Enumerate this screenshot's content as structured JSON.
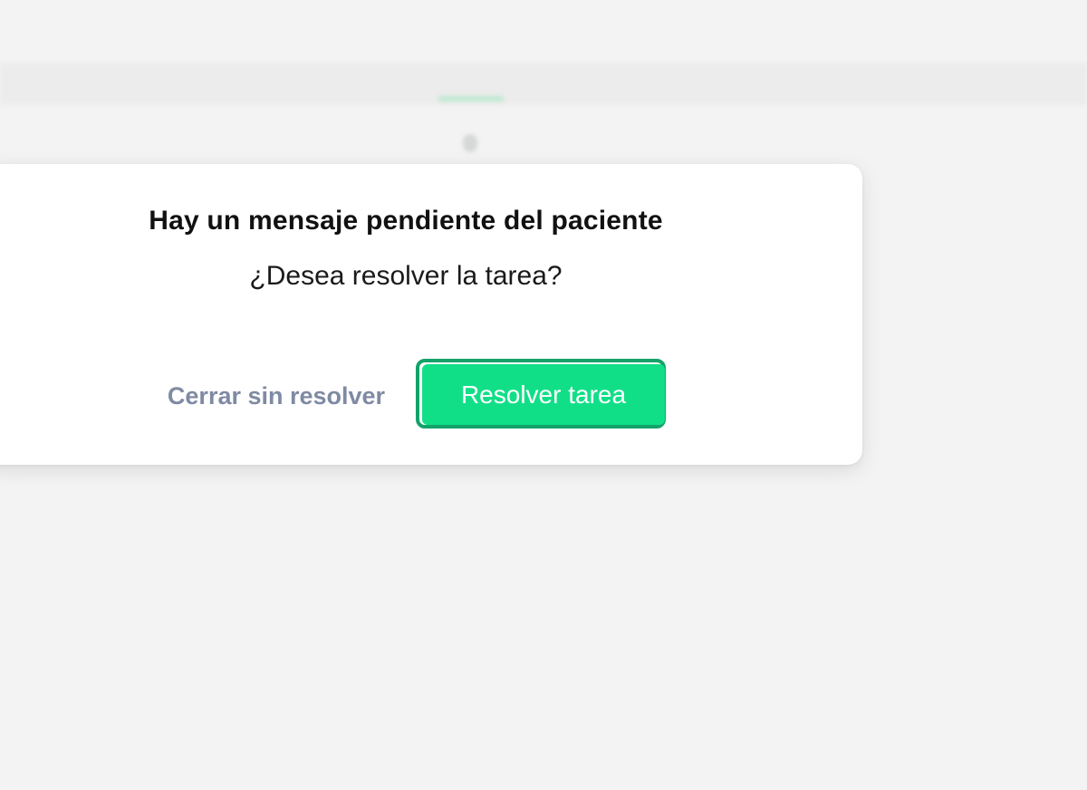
{
  "dialog": {
    "title": "Hay un mensaje pendiente del paciente",
    "subtitle": "¿Desea resolver la tarea?",
    "secondary_button_label": "Cerrar sin resolver",
    "primary_button_label": "Resolver tarea"
  },
  "colors": {
    "primary_green": "#11df88",
    "focus_ring": "#13a36a",
    "secondary_text": "#7f8aa3",
    "backdrop": "#f2f3f2"
  }
}
